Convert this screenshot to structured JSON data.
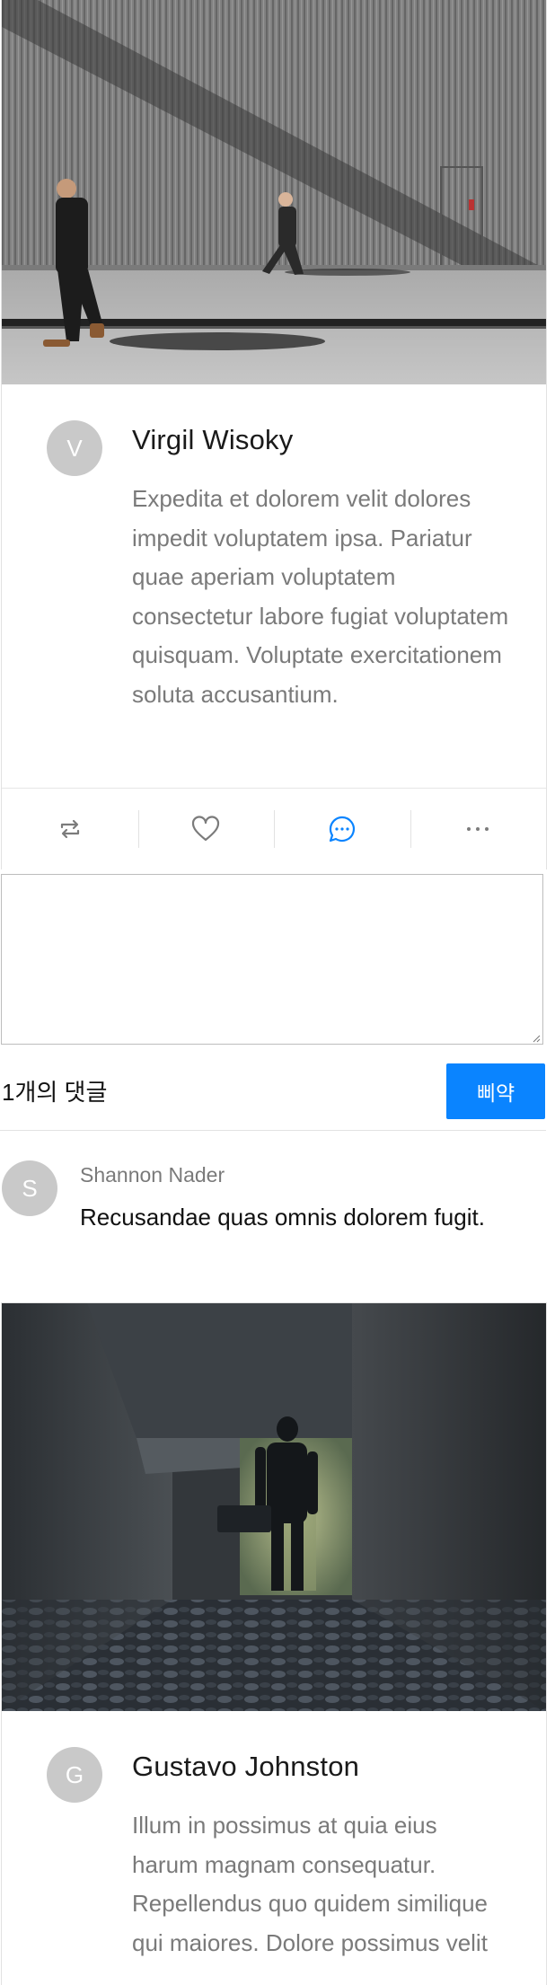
{
  "posts": [
    {
      "author": "Virgil Wisoky",
      "avatar_initial": "V",
      "text": "Expedita et dolorem velit dolores impedit voluptatem ipsa. Pariatur quae aperiam voluptatem consectetur labore fugiat voluptatem quisquam. Voluptate exercitationem soluta accusantium.",
      "image": "street-photo",
      "actions": [
        {
          "icon": "repost-icon",
          "active": false
        },
        {
          "icon": "heart-icon",
          "active": false
        },
        {
          "icon": "comment-icon",
          "active": true
        },
        {
          "icon": "more-icon",
          "active": false
        }
      ],
      "comment_input": {
        "value": "",
        "placeholder": ""
      },
      "comment_count_label": "1개의 댓글",
      "submit_label": "삐약",
      "comments": [
        {
          "author": "Shannon Nader",
          "avatar_initial": "S",
          "text": "Recusandae quas omnis dolorem fugit."
        }
      ]
    },
    {
      "author": "Gustavo Johnston",
      "avatar_initial": "G",
      "text": "Illum in possimus at quia eius harum magnam consequatur. Repellendus quo quidem similique qui maiores. Dolore possimus velit",
      "image": "corridor-photo"
    }
  ],
  "colors": {
    "accent": "#0a84ff",
    "avatar_bg": "#c9c9c9",
    "muted_text": "#7a7a7a",
    "icon_gray": "#7b7b7b"
  }
}
